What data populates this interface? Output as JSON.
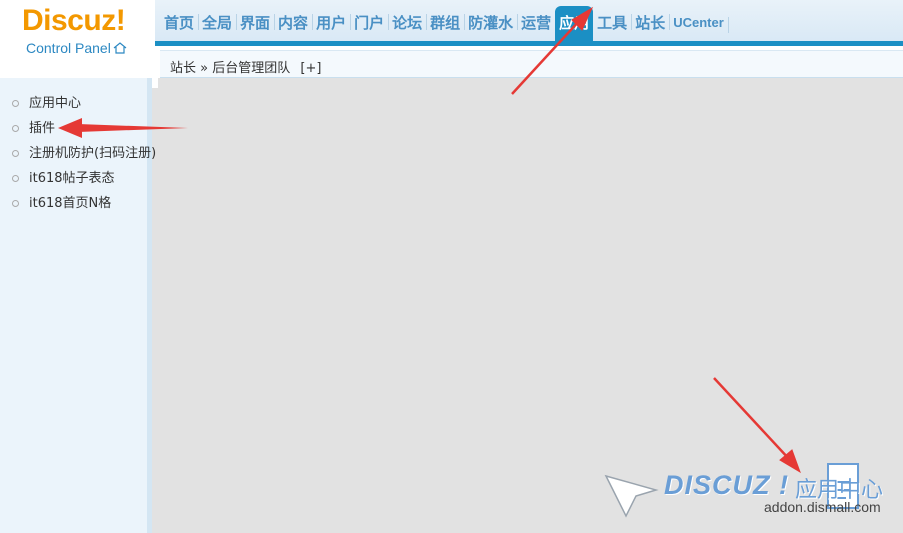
{
  "logo": {
    "brand": "Discuz!",
    "subtitle": "Control Panel"
  },
  "topnav": {
    "items": [
      {
        "label": "首页"
      },
      {
        "label": "全局"
      },
      {
        "label": "界面"
      },
      {
        "label": "内容"
      },
      {
        "label": "用户"
      },
      {
        "label": "门户"
      },
      {
        "label": "论坛"
      },
      {
        "label": "群组"
      },
      {
        "label": "防灌水"
      },
      {
        "label": "运营"
      },
      {
        "label": "应用",
        "active": true
      },
      {
        "label": "工具"
      },
      {
        "label": "站长"
      },
      {
        "label": "UCenter"
      }
    ]
  },
  "breadcrumb": {
    "root": "站长",
    "separator": "»",
    "current": "后台管理团队",
    "add": "[+]"
  },
  "sidebar": {
    "items": [
      {
        "label": "应用中心"
      },
      {
        "label": "插件"
      },
      {
        "label": "注册机防护(扫码注册)"
      },
      {
        "label": "it618帖子表态"
      },
      {
        "label": "it618首页N格"
      }
    ]
  },
  "watermark": {
    "brand": "DISCUZ !",
    "label": "应用中心",
    "url": "addon.dismall.com"
  },
  "colors": {
    "accent": "#1b8fc4",
    "logo": "#f39800",
    "annotation": "#e53935"
  }
}
